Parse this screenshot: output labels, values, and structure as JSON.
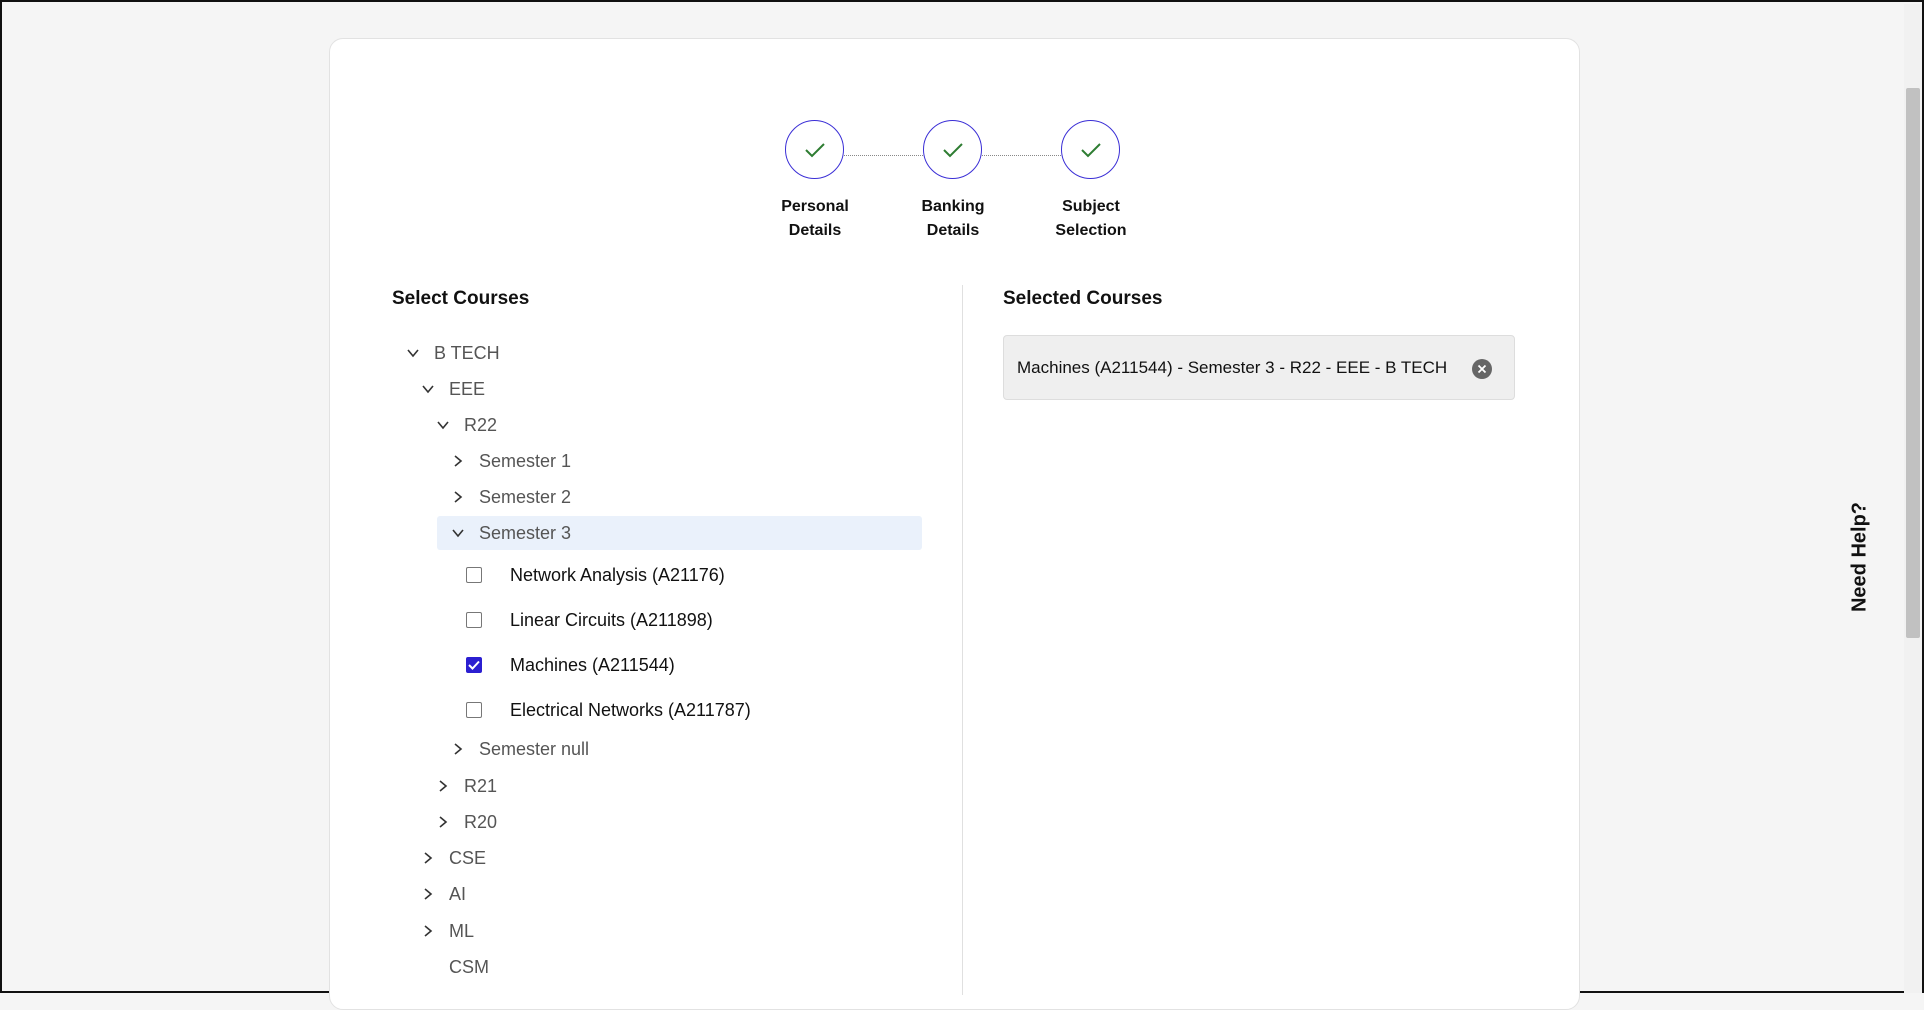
{
  "stepper": {
    "steps": [
      {
        "label": "Personal\nDetails",
        "status": "complete",
        "icon": "check-icon"
      },
      {
        "label": "Banking\nDetails",
        "status": "complete",
        "icon": "check-icon"
      },
      {
        "label": "Subject\nSelection",
        "status": "complete",
        "icon": "check-icon"
      }
    ],
    "check_color": "#2e7d32",
    "circle_color": "#3b2fd6"
  },
  "left_panel": {
    "title": "Select Courses",
    "tree": {
      "btech": "B TECH",
      "eee": "EEE",
      "r22": "R22",
      "semester1": "Semester 1",
      "semester2": "Semester 2",
      "semester3": "Semester 3",
      "courses": [
        {
          "label": "Network Analysis (A21176)",
          "checked": false
        },
        {
          "label": "Linear Circuits (A211898)",
          "checked": false
        },
        {
          "label": "Machines (A211544)",
          "checked": true
        },
        {
          "label": "Electrical Networks (A211787)",
          "checked": false
        }
      ],
      "semester_null": "Semester null",
      "r21": "R21",
      "r20": "R20",
      "cse": "CSE",
      "ai": "AI",
      "ml": "ML",
      "csm": "CSM"
    }
  },
  "right_panel": {
    "title": "Selected Courses",
    "selected": [
      {
        "label": "Machines (A211544) - Semester 3 - R22 - EEE - B TECH",
        "remove_icon": "close-circle-icon"
      }
    ]
  },
  "help": {
    "label": "Need Help?"
  },
  "colors": {
    "accent": "#2b1fd1",
    "highlight": "#eaf1fb"
  }
}
